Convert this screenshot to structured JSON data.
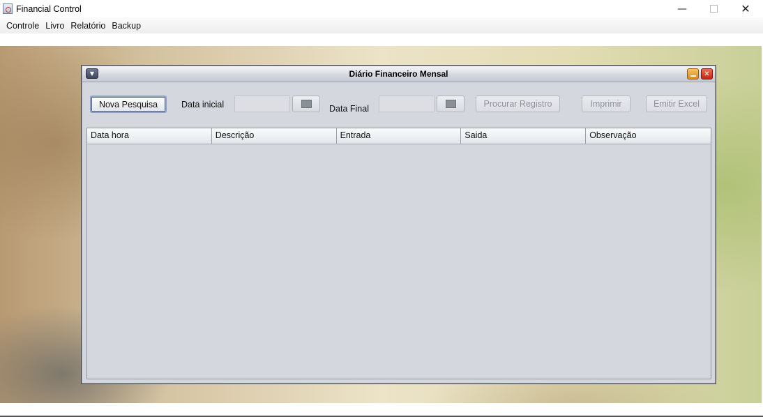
{
  "window": {
    "title": "Financial Control",
    "minimize_symbol": "—",
    "close_symbol": "✕"
  },
  "menu": {
    "items": [
      "Controle",
      "Livro",
      "Relatório",
      "Backup"
    ]
  },
  "frame": {
    "title": "Diário Financeiro Mensal",
    "menu_symbol": "▼",
    "close_symbol": "✕"
  },
  "toolbar": {
    "new_search": "Nova Pesquisa",
    "start_date_label": "Data inicial",
    "start_date_value": "",
    "end_date_label": "Data Final",
    "end_date_value": "",
    "search_record": "Procurar Registro",
    "print": "Imprimir",
    "export_excel": "Emitir Excel"
  },
  "table": {
    "columns": [
      "Data hora",
      "Descrição",
      "Entrada",
      "Saida",
      "Observação"
    ],
    "rows": []
  },
  "icons": {
    "app": "java-cup-icon",
    "calendar": "calendar-icon"
  }
}
